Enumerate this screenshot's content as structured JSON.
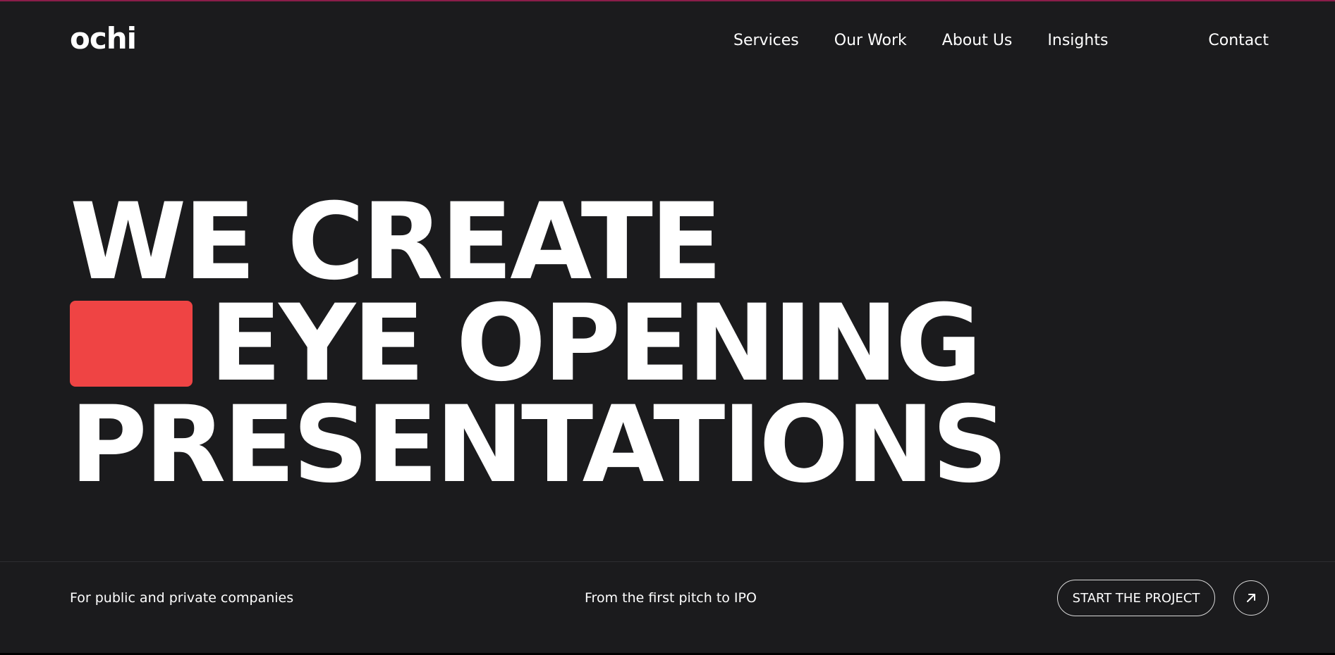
{
  "brand": {
    "logo_text": "ochi"
  },
  "nav": {
    "items": [
      {
        "label": "Services"
      },
      {
        "label": "Our Work"
      },
      {
        "label": "About Us"
      },
      {
        "label": "Insights"
      }
    ],
    "contact_label": "Contact"
  },
  "hero": {
    "line1": "WE CREATE",
    "line2": "EYE OPENING",
    "line3": "PRESENTATIONS"
  },
  "footer": {
    "left_text": "For public and private companies",
    "middle_text": "From the first pitch to IPO",
    "cta_label": "START THE PROJECT",
    "arrow_icon": "arrow-up-right-icon"
  },
  "colors": {
    "background": "#1b1b1d",
    "accent": "#ef4444",
    "text": "#ffffff"
  }
}
